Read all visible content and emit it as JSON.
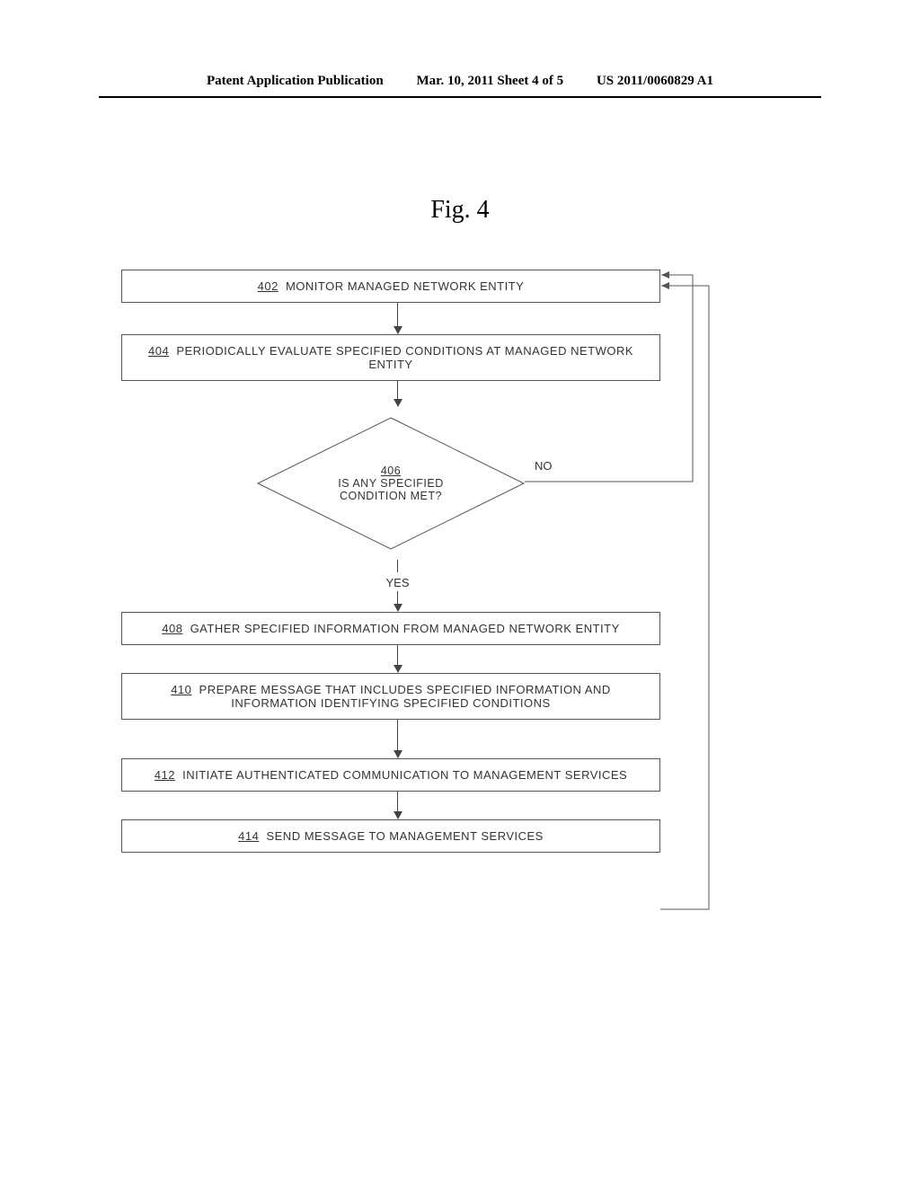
{
  "header": {
    "left": "Patent Application Publication",
    "center": "Mar. 10, 2011  Sheet 4 of 5",
    "right": "US 2011/0060829 A1"
  },
  "figure_title": "Fig. 4",
  "steps": {
    "s402": {
      "num": "402",
      "text": "MONITOR MANAGED NETWORK ENTITY"
    },
    "s404": {
      "num": "404",
      "text": "PERIODICALLY EVALUATE SPECIFIED CONDITIONS AT MANAGED NETWORK ENTITY"
    },
    "s406": {
      "num": "406",
      "text": "IS ANY SPECIFIED CONDITION MET?"
    },
    "s408": {
      "num": "408",
      "text": "GATHER SPECIFIED INFORMATION FROM MANAGED NETWORK ENTITY"
    },
    "s410": {
      "num": "410",
      "text": "PREPARE MESSAGE THAT INCLUDES SPECIFIED INFORMATION AND INFORMATION IDENTIFYING SPECIFIED CONDITIONS"
    },
    "s412": {
      "num": "412",
      "text": "INITIATE AUTHENTICATED COMMUNICATION TO MANAGEMENT SERVICES"
    },
    "s414": {
      "num": "414",
      "text": "SEND MESSAGE TO MANAGEMENT SERVICES"
    }
  },
  "branches": {
    "no": "NO",
    "yes": "YES"
  },
  "chart_data": {
    "type": "flowchart",
    "nodes": [
      {
        "id": "402",
        "type": "process",
        "label": "MONITOR MANAGED NETWORK ENTITY"
      },
      {
        "id": "404",
        "type": "process",
        "label": "PERIODICALLY EVALUATE SPECIFIED CONDITIONS AT MANAGED NETWORK ENTITY"
      },
      {
        "id": "406",
        "type": "decision",
        "label": "IS ANY SPECIFIED CONDITION MET?"
      },
      {
        "id": "408",
        "type": "process",
        "label": "GATHER SPECIFIED INFORMATION FROM MANAGED NETWORK ENTITY"
      },
      {
        "id": "410",
        "type": "process",
        "label": "PREPARE MESSAGE THAT INCLUDES SPECIFIED INFORMATION AND INFORMATION IDENTIFYING SPECIFIED CONDITIONS"
      },
      {
        "id": "412",
        "type": "process",
        "label": "INITIATE AUTHENTICATED COMMUNICATION TO MANAGEMENT SERVICES"
      },
      {
        "id": "414",
        "type": "process",
        "label": "SEND MESSAGE TO MANAGEMENT SERVICES"
      }
    ],
    "edges": [
      {
        "from": "402",
        "to": "404"
      },
      {
        "from": "404",
        "to": "406"
      },
      {
        "from": "406",
        "to": "402",
        "label": "NO"
      },
      {
        "from": "406",
        "to": "408",
        "label": "YES"
      },
      {
        "from": "408",
        "to": "410"
      },
      {
        "from": "410",
        "to": "412"
      },
      {
        "from": "412",
        "to": "414"
      },
      {
        "from": "414",
        "to": "402"
      }
    ]
  }
}
